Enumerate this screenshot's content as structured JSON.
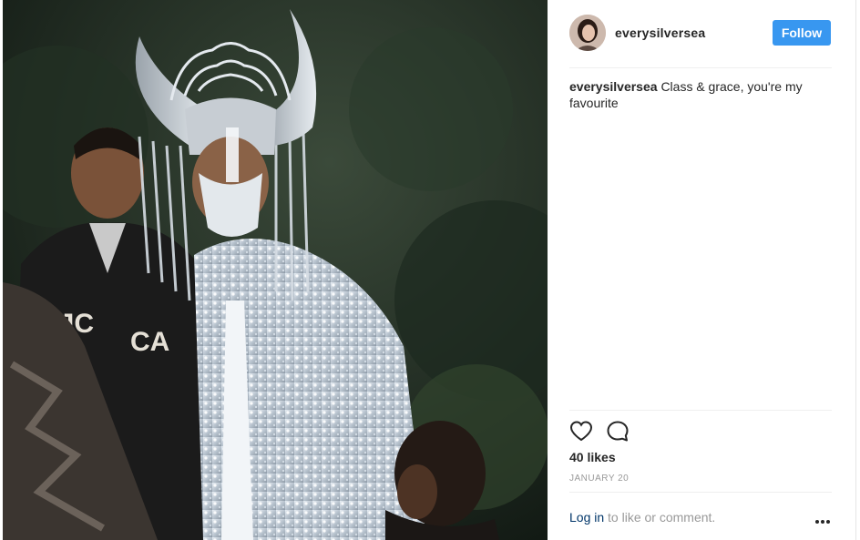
{
  "post": {
    "username": "everysilversea",
    "follow_label": "Follow",
    "caption": {
      "username": "everysilversea",
      "text": "Class & grace, you're my favourite"
    },
    "likes": "40 likes",
    "date": "JANUARY 20",
    "comment_prompt": {
      "login_label": "Log in",
      "rest": " to like or comment."
    }
  },
  "icons": {
    "like": "heart-icon",
    "comment": "comment-bubble-icon",
    "more": "more-options-icon"
  },
  "colors": {
    "follow_button": "#3897f0",
    "link": "#003569",
    "muted": "#999999",
    "text": "#262626"
  }
}
